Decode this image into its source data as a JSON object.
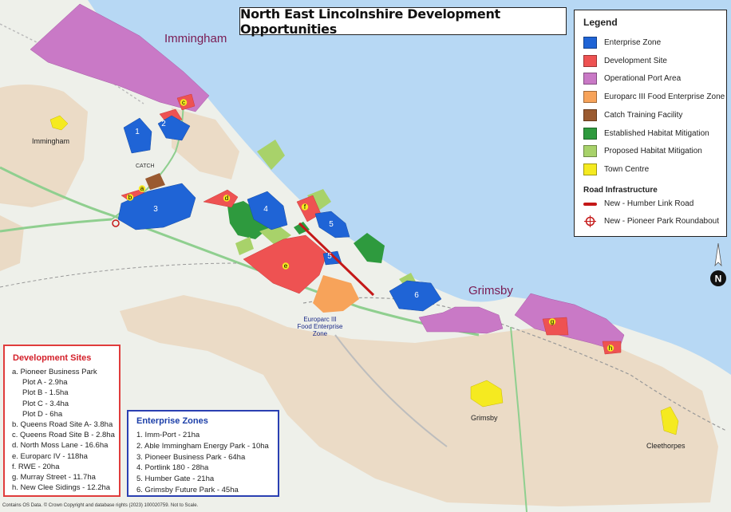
{
  "title": "North East Lincolnshire Development Opportunities",
  "legend": {
    "title": "Legend",
    "items": [
      {
        "label": "Enterprise Zone",
        "color": "#1f64d6"
      },
      {
        "label": "Development Site",
        "color": "#ee5252"
      },
      {
        "label": "Operational Port Area",
        "color": "#c979c6"
      },
      {
        "label": "Europarc III Food Enterprise Zone",
        "color": "#f7a35a"
      },
      {
        "label": "Catch Training Facility",
        "color": "#9a5a30"
      },
      {
        "label": "Established Habitat Mitigation",
        "color": "#2e9a3e"
      },
      {
        "label": "Proposed Habitat Mitigation",
        "color": "#a8d26a"
      },
      {
        "label": "Town Centre",
        "color": "#f5ea20"
      }
    ],
    "road_title": "Road Infrastructure",
    "road_items": [
      {
        "label": "New - Humber Link Road",
        "color": "#c41818"
      },
      {
        "label": "New - Pioneer Park Roundabout",
        "color": "#c41818"
      }
    ]
  },
  "development_sites": {
    "title": "Development Sites",
    "lines": [
      "a. Pioneer Business Park",
      "Plot A - 2.9ha",
      "Plot B - 1.5ha",
      "Plot C - 3.4ha",
      "Plot D - 6ha",
      "b. Queens Road Site A- 3.8ha",
      "c. Queens Road Site B - 2.8ha",
      "d. North Moss Lane - 16.6ha",
      "e. Europarc IV - 118ha",
      "f. RWE - 20ha",
      "g. Murray Street - 11.7ha",
      "h. New Clee Sidings - 12.2ha"
    ]
  },
  "enterprise_zones": {
    "title": "Enterprise Zones",
    "lines": [
      "1. Imm-Port - 21ha",
      "2. Able Immingham Energy Park - 10ha",
      "3. Pioneer Business Park - 64ha",
      "4. Portlink 180 - 28ha",
      "5. Humber Gate - 21ha",
      "6. Grimsby Future Park - 45ha"
    ]
  },
  "places": {
    "immingham_large": "Immingham",
    "immingham_small": "Immingham",
    "grimsby_large": "Grimsby",
    "grimsby_small": "Grimsby",
    "cleethorpes": "Cleethorpes",
    "catch": "CATCH",
    "europarc": [
      "Europarc III",
      "Food Enterprise",
      "Zone"
    ]
  },
  "site_labels": {
    "ez": [
      "1",
      "2",
      "3",
      "4",
      "5",
      "5",
      "6"
    ],
    "dev": [
      "a",
      "b",
      "c",
      "d",
      "e",
      "f",
      "g",
      "h"
    ]
  },
  "north_arrow": "N",
  "copyright": "Contains OS Data. © Crown Copyright and database rights (2023) 100020759. Not to Scale.",
  "colors": {
    "sea": "#b7d8f4",
    "land": "#eef0ea",
    "urban": "#ead7bf",
    "road": "#8fcf8f"
  }
}
